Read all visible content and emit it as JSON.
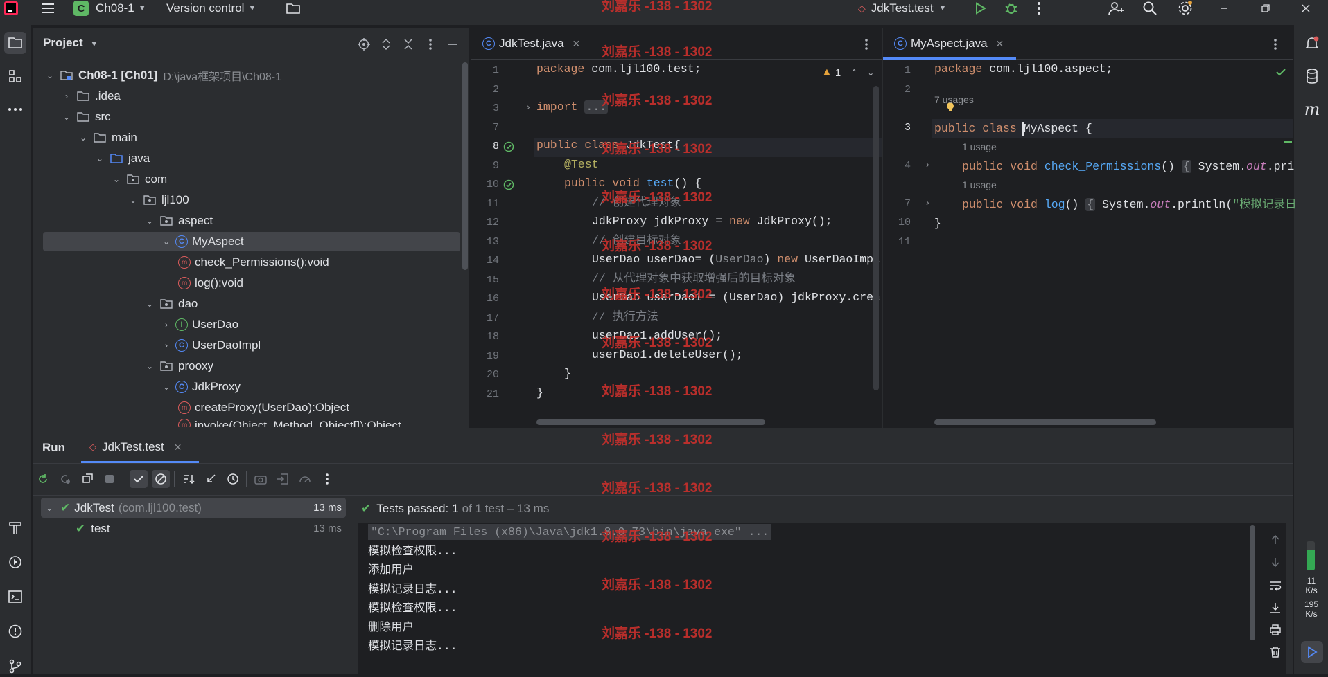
{
  "titlebar": {
    "project_badge": "C",
    "project_name": "Ch08-1",
    "vcs": "Version control",
    "run_config": "JdkTest.test"
  },
  "watermark": "刘嘉乐 -138 - 1302",
  "project_panel": {
    "title": "Project",
    "tree": [
      {
        "label": "Ch08-1 [Ch01]",
        "extra": "D:\\java框架项目\\Ch08-1"
      },
      {
        "label": ".idea"
      },
      {
        "label": "src"
      },
      {
        "label": "main"
      },
      {
        "label": "java"
      },
      {
        "label": "com"
      },
      {
        "label": "ljl100"
      },
      {
        "label": "aspect"
      },
      {
        "label": "MyAspect"
      },
      {
        "label": "check_Permissions():void"
      },
      {
        "label": "log():void"
      },
      {
        "label": "dao"
      },
      {
        "label": "UserDao"
      },
      {
        "label": "UserDaoImpl"
      },
      {
        "label": "prooxy"
      },
      {
        "label": "JdkProxy"
      },
      {
        "label": "createProxy(UserDao):Object"
      },
      {
        "label": "invoke(Object, Method, Object[]):Object"
      }
    ]
  },
  "editor1": {
    "tab": "JdkTest.java",
    "warning_count": "1",
    "line_numbers": [
      "1",
      "2",
      "3",
      "7",
      "8",
      "9",
      "10",
      "11",
      "12",
      "13",
      "14",
      "15",
      "16",
      "17",
      "18",
      "19",
      "20",
      "21"
    ],
    "lines": {
      "l1_kw": "package",
      "l1_rest": " com.ljl100.test;",
      "l3_kw": "import",
      "l3_fold": "...",
      "l8_kw": "public class",
      "l8_rest": " JdkTest{",
      "l9": "@Test",
      "l10_kw": "public void",
      "l10_fn": "test",
      "l10_rest": "() {",
      "l11": "// 创建代理对象",
      "l12_a": "JdkProxy jdkProxy = ",
      "l12_kw": "new",
      "l12_b": " JdkProxy();",
      "l13": "// 创建目标对象",
      "l14_a": "UserDao userDao= (",
      "l14_cast": "UserDao",
      "l14_b": ") ",
      "l14_kw": "new",
      "l14_c": " UserDaoImpl",
      "l15": "// 从代理对象中获取增强后的目标对象",
      "l16": "UserDao userDao1 = (UserDao) jdkProxy.crea",
      "l17": "// 执行方法",
      "l18": "userDao1.addUser();",
      "l19": "userDao1.deleteUser();",
      "l20": "}",
      "l21": "}"
    }
  },
  "editor2": {
    "tab": "MyAspect.java",
    "line_numbers": [
      "1",
      "2",
      "3",
      "4",
      "7",
      "10",
      "11"
    ],
    "usages_top": "7 usages",
    "usage1": "1 usage",
    "usage2": "1 usage",
    "lines": {
      "l1_kw": "package",
      "l1_rest": " com.ljl100.aspect;",
      "l3_kw": "public class",
      "l3_rest": " MyAspect {",
      "l4_kw": "public void",
      "l4_fn": "check_Permissions",
      "l4_par": "()",
      "l4_fold": "{",
      "l4_a": " System.",
      "l4_it": "out",
      "l4_b": ".pri",
      "l7_kw": "public void",
      "l7_fn": "log",
      "l7_par": "()",
      "l7_fold": "{",
      "l7_a": " System.",
      "l7_it": "out",
      "l7_b": ".println(",
      "l7_st": "\"模拟记录日",
      "l10": "}"
    }
  },
  "run_panel": {
    "title": "Run",
    "tab": "JdkTest.test",
    "tests": [
      {
        "name": "JdkTest",
        "pkg": "(com.ljl100.test)",
        "time": "13 ms"
      },
      {
        "name": "test",
        "time": "13 ms"
      }
    ],
    "status_prefix": "Tests passed:",
    "status_count": "1",
    "status_rest": "of 1 test – 13 ms",
    "console": [
      "\"C:\\Program Files (x86)\\Java\\jdk1.8.0_73\\bin\\java.exe\" ...",
      "模拟检查权限...",
      "添加用户",
      "模拟记录日志...",
      "模拟检查权限...",
      "删除用户",
      "模拟记录日志..."
    ]
  },
  "memory": {
    "up": "11",
    "up_unit": "K/s",
    "down": "195",
    "down_unit": "K/s"
  },
  "colors": {
    "bg": "#1e1f22",
    "panel": "#2b2d30",
    "accent": "#548af7",
    "keyword": "#cf8e6d",
    "function": "#56a8f5",
    "success": "#5fb865",
    "watermark": "#c6302c"
  }
}
